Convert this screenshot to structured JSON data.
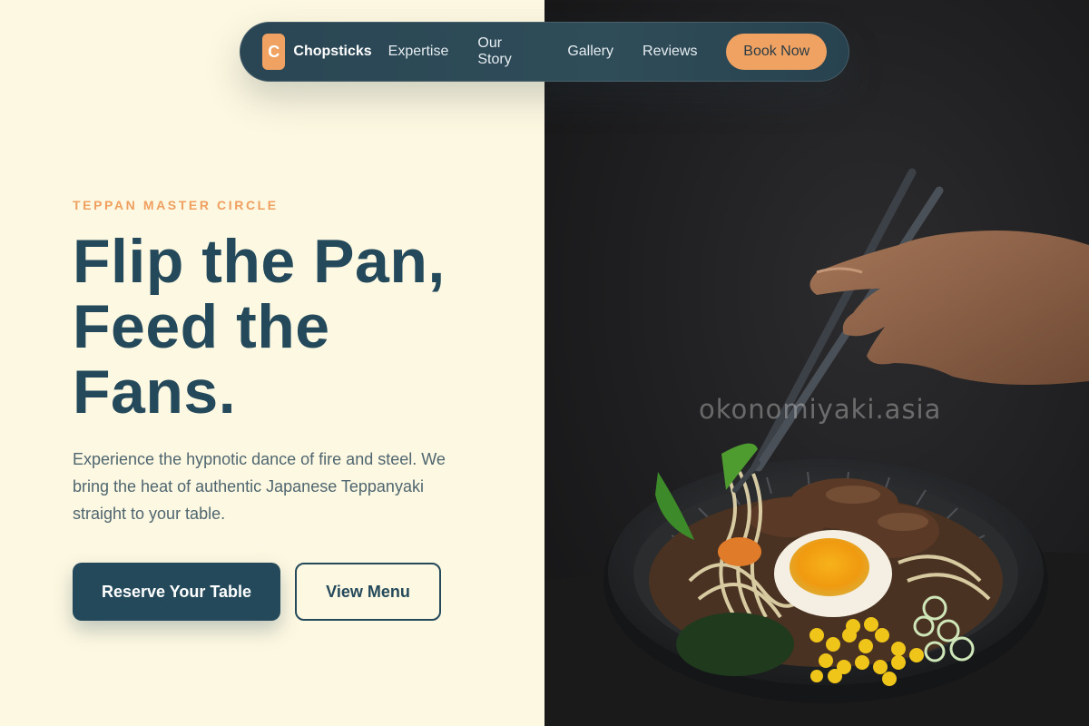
{
  "nav": {
    "logo_letter": "C",
    "brand": "Chopsticks",
    "links": [
      "Expertise",
      "Our Story",
      "Gallery",
      "Reviews"
    ],
    "cta": "Book Now"
  },
  "hero": {
    "eyebrow": "TEPPAN MASTER CIRCLE",
    "headline_lines": [
      "Flip the Pan,",
      "Feed the",
      "Fans."
    ],
    "description": "Experience the hypnotic dance of fire and steel. We bring the heat of authentic Japanese Teppanyaki straight to your table.",
    "primary_button": "Reserve Your Table",
    "secondary_button": "View Menu"
  },
  "image": {
    "watermark": "okonomiyaki.asia",
    "icon": "ramen-bowl-with-chopsticks-photo"
  },
  "colors": {
    "background": "#fdf8e1",
    "accent": "#f0a262",
    "primary": "#24495b",
    "photo_bg": "#1e1e20"
  }
}
